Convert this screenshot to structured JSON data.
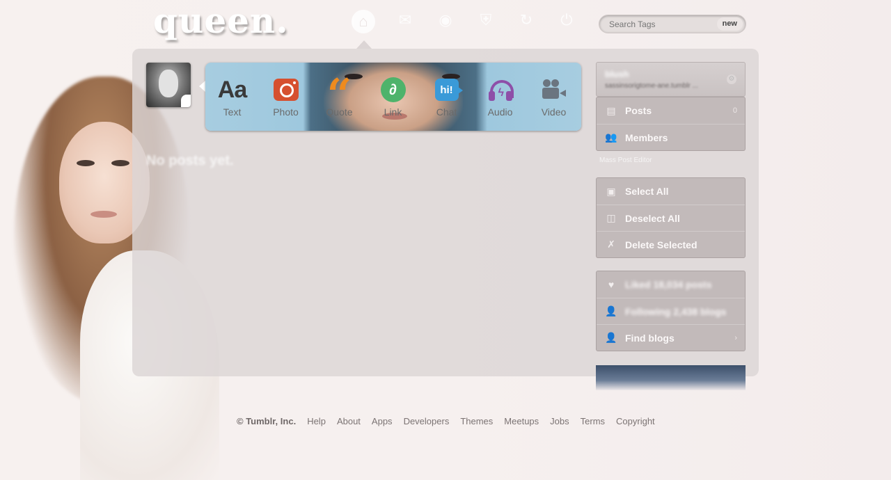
{
  "header": {
    "logo": "queen.",
    "nav_icons": [
      "home-icon",
      "mail-icon",
      "compass-icon",
      "shield-icon",
      "refresh-icon",
      "power-icon"
    ],
    "search": {
      "placeholder": "Search Tags",
      "new_label": "new"
    }
  },
  "post_bar": {
    "types": [
      {
        "label": "Text",
        "icon": "text-icon"
      },
      {
        "label": "Photo",
        "icon": "photo-icon"
      },
      {
        "label": "Quote",
        "icon": "quote-icon"
      },
      {
        "label": "Link",
        "icon": "link-icon"
      },
      {
        "label": "Chat",
        "icon": "chat-icon"
      },
      {
        "label": "Audio",
        "icon": "audio-icon"
      },
      {
        "label": "Video",
        "icon": "video-icon"
      }
    ]
  },
  "main": {
    "empty_message": "No posts yet."
  },
  "sidebar": {
    "blog_name": "blush",
    "blog_url": "sassinsorigtome-ane.tumblr ...",
    "items": [
      {
        "label": "Posts",
        "count": "0"
      },
      {
        "label": "Members",
        "count": ""
      }
    ],
    "mass_post_editor": "Mass Post Editor",
    "actions": [
      {
        "label": "Select All"
      },
      {
        "label": "Deselect All"
      },
      {
        "label": "Delete Selected"
      }
    ],
    "stats": [
      {
        "label": "Liked 18,034 posts"
      },
      {
        "label": "Following 2,438 blogs"
      },
      {
        "label": "Find blogs"
      }
    ]
  },
  "footer": {
    "copyright": "© Tumblr, Inc.",
    "links": [
      "Help",
      "About",
      "Apps",
      "Developers",
      "Themes",
      "Meetups",
      "Jobs",
      "Terms",
      "Copyright"
    ]
  }
}
